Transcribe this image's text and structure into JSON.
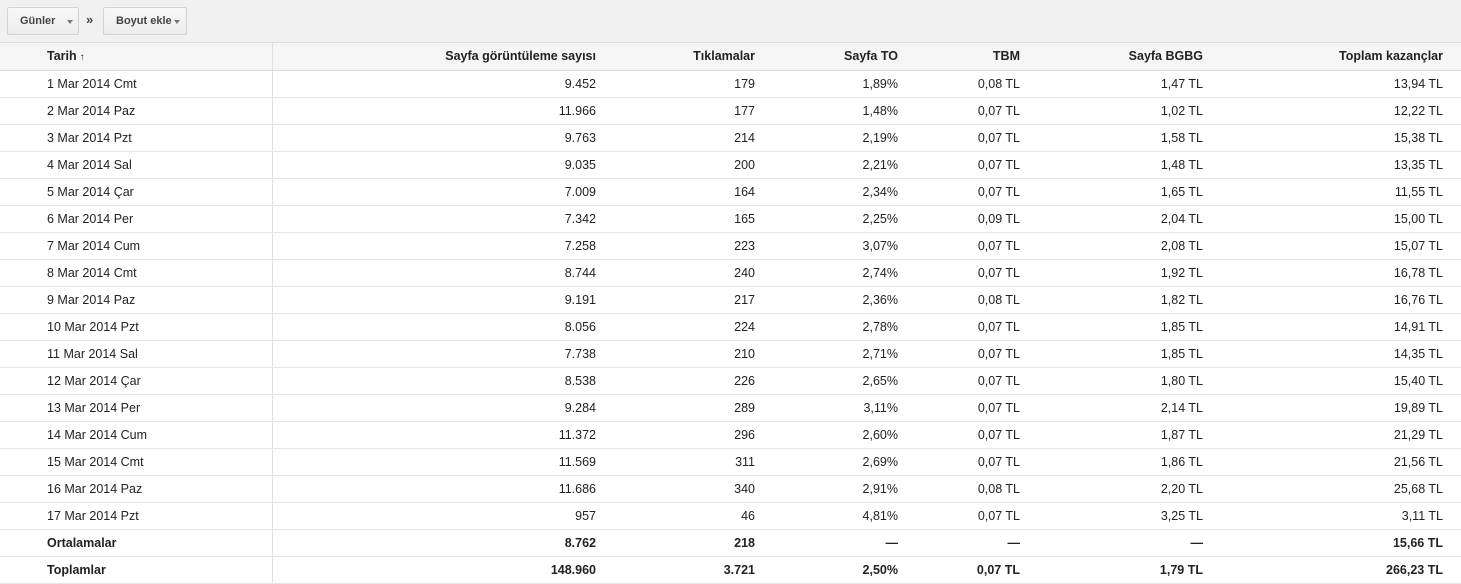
{
  "toolbar": {
    "dimension_label": "Günler",
    "separator": "»",
    "add_dimension_label": "Boyut ekle"
  },
  "table": {
    "headers": [
      "Tarih",
      "Sayfa görüntüleme sayısı",
      "Tıklamalar",
      "Sayfa TO",
      "TBM",
      "Sayfa BGBG",
      "Toplam kazançlar"
    ],
    "sort_indicator": "↑",
    "rows": [
      [
        "1 Mar 2014 Cmt",
        "9.452",
        "179",
        "1,89%",
        "0,08 TL",
        "1,47 TL",
        "13,94 TL"
      ],
      [
        "2 Mar 2014 Paz",
        "11.966",
        "177",
        "1,48%",
        "0,07 TL",
        "1,02 TL",
        "12,22 TL"
      ],
      [
        "3 Mar 2014 Pzt",
        "9.763",
        "214",
        "2,19%",
        "0,07 TL",
        "1,58 TL",
        "15,38 TL"
      ],
      [
        "4 Mar 2014 Sal",
        "9.035",
        "200",
        "2,21%",
        "0,07 TL",
        "1,48 TL",
        "13,35 TL"
      ],
      [
        "5 Mar 2014 Çar",
        "7.009",
        "164",
        "2,34%",
        "0,07 TL",
        "1,65 TL",
        "11,55 TL"
      ],
      [
        "6 Mar 2014 Per",
        "7.342",
        "165",
        "2,25%",
        "0,09 TL",
        "2,04 TL",
        "15,00 TL"
      ],
      [
        "7 Mar 2014 Cum",
        "7.258",
        "223",
        "3,07%",
        "0,07 TL",
        "2,08 TL",
        "15,07 TL"
      ],
      [
        "8 Mar 2014 Cmt",
        "8.744",
        "240",
        "2,74%",
        "0,07 TL",
        "1,92 TL",
        "16,78 TL"
      ],
      [
        "9 Mar 2014 Paz",
        "9.191",
        "217",
        "2,36%",
        "0,08 TL",
        "1,82 TL",
        "16,76 TL"
      ],
      [
        "10 Mar 2014 Pzt",
        "8.056",
        "224",
        "2,78%",
        "0,07 TL",
        "1,85 TL",
        "14,91 TL"
      ],
      [
        "11 Mar 2014 Sal",
        "7.738",
        "210",
        "2,71%",
        "0,07 TL",
        "1,85 TL",
        "14,35 TL"
      ],
      [
        "12 Mar 2014 Çar",
        "8.538",
        "226",
        "2,65%",
        "0,07 TL",
        "1,80 TL",
        "15,40 TL"
      ],
      [
        "13 Mar 2014 Per",
        "9.284",
        "289",
        "3,11%",
        "0,07 TL",
        "2,14 TL",
        "19,89 TL"
      ],
      [
        "14 Mar 2014 Cum",
        "11.372",
        "296",
        "2,60%",
        "0,07 TL",
        "1,87 TL",
        "21,29 TL"
      ],
      [
        "15 Mar 2014 Cmt",
        "11.569",
        "311",
        "2,69%",
        "0,07 TL",
        "1,86 TL",
        "21,56 TL"
      ],
      [
        "16 Mar 2014 Paz",
        "11.686",
        "340",
        "2,91%",
        "0,08 TL",
        "2,20 TL",
        "25,68 TL"
      ],
      [
        "17 Mar 2014 Pzt",
        "957",
        "46",
        "4,81%",
        "0,07 TL",
        "3,25 TL",
        "3,11 TL"
      ]
    ],
    "averages": [
      "Ortalamalar",
      "8.762",
      "218",
      "—",
      "—",
      "—",
      "15,66 TL"
    ],
    "totals": [
      "Toplamlar",
      "148.960",
      "3.721",
      "2,50%",
      "0,07 TL",
      "1,79 TL",
      "266,23 TL"
    ]
  }
}
